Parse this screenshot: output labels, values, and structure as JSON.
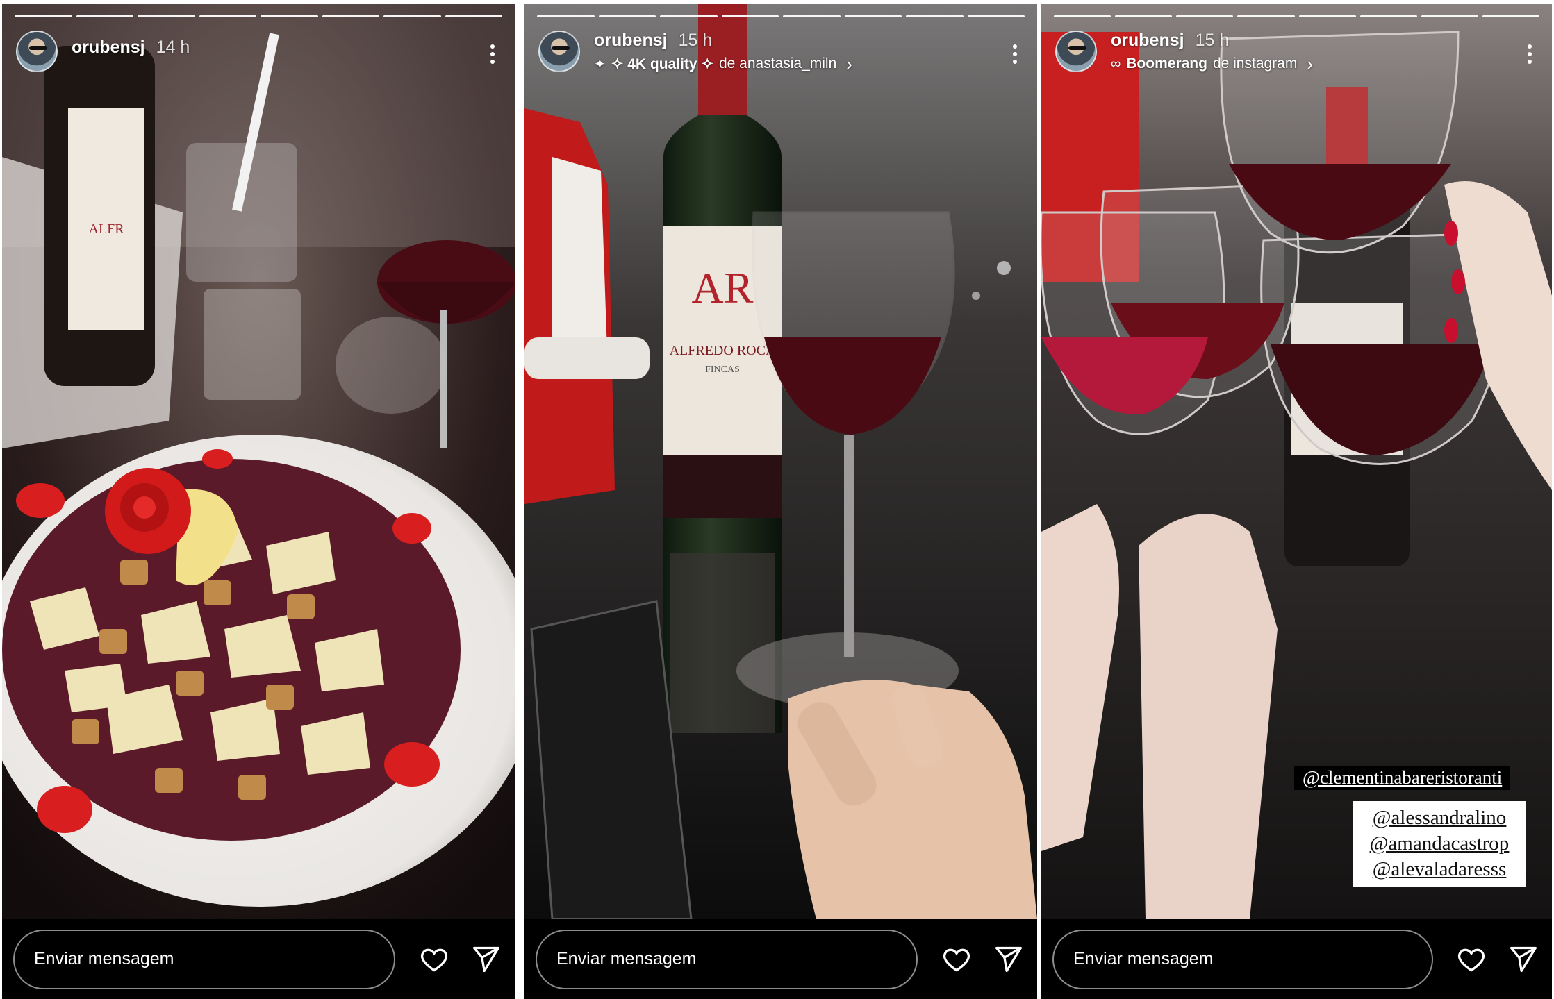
{
  "stories": [
    {
      "username": "orubensj",
      "time": "14 h",
      "subline": null,
      "progress": {
        "total": 8,
        "viewed": 8
      },
      "message_placeholder": "Enviar mensagem",
      "media_alt": "Plate of carpaccio with parmesan, croutons and lemon, wine bottle and glasses on table",
      "icons": {
        "more": "more-vertical-icon",
        "like": "heart-icon",
        "share": "send-icon"
      }
    },
    {
      "username": "orubensj",
      "time": "15 h",
      "subline": {
        "prefix_icon": "sparkle-icon",
        "quality": "✧ 4K quality ✧",
        "source_label": "de anastasia_miln"
      },
      "progress": {
        "total": 8,
        "viewed": 8
      },
      "message_placeholder": "Enviar mensagem",
      "media_alt": "Bottle of Alfredo Roca wine next to a glass of red wine",
      "icons": {
        "more": "more-vertical-icon",
        "like": "heart-icon",
        "share": "send-icon"
      }
    },
    {
      "username": "orubensj",
      "time": "15 h",
      "subline": {
        "prefix_icon": "infinity-icon",
        "quality": "Boomerang",
        "source_label": "de instagram"
      },
      "progress": {
        "total": 8,
        "viewed": 8
      },
      "message_placeholder": "Enviar mensagem",
      "media_alt": "Hands toasting with glasses of red wine",
      "mentions": {
        "venue": "@clementinabareristoranti",
        "people": [
          "@alessandralino",
          "@amandacastrop",
          "@alevaladaresss"
        ]
      },
      "icons": {
        "more": "more-vertical-icon",
        "like": "heart-icon",
        "share": "send-icon"
      }
    }
  ],
  "colors": {
    "background": "#000000",
    "text": "#ffffff",
    "wine": "#5a0f1a",
    "rose": "#d81e1e"
  }
}
